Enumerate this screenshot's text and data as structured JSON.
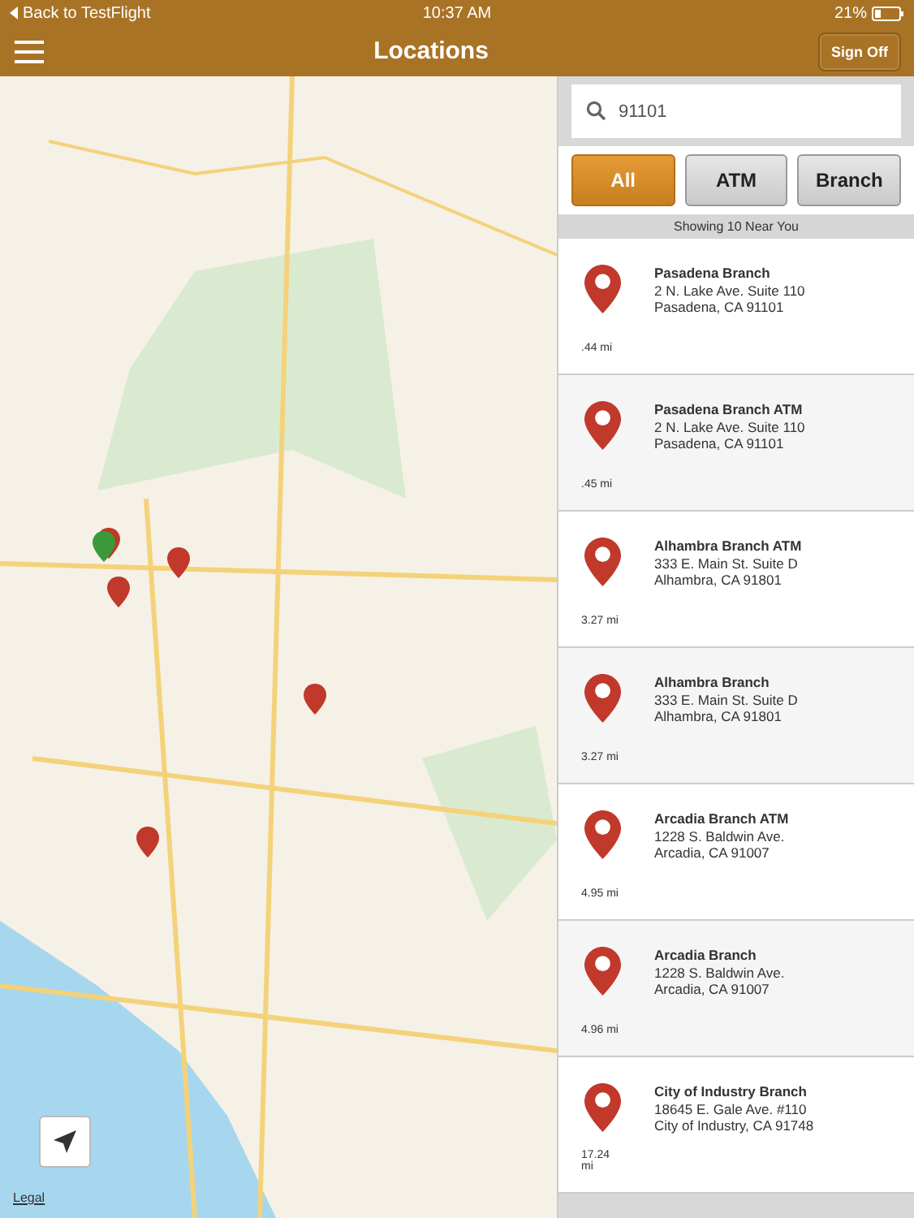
{
  "status_bar": {
    "back": "Back to TestFlight",
    "time": "10:37 AM",
    "battery": "21%"
  },
  "nav": {
    "title": "Locations",
    "action": "Sign Off"
  },
  "map": {
    "legal": "Legal"
  },
  "search": {
    "value": "91101"
  },
  "filters": [
    {
      "label": "All",
      "selected": true
    },
    {
      "label": "ATM",
      "selected": false
    },
    {
      "label": "Branch",
      "selected": false
    }
  ],
  "summary": "Showing 10 Near You",
  "locations": [
    {
      "name": "Pasadena Branch",
      "address": "2 N. Lake Ave. Suite 110",
      "city": "Pasadena, CA 91101",
      "distance": ".44 mi"
    },
    {
      "name": "Pasadena Branch ATM",
      "address": "2 N. Lake Ave. Suite 110",
      "city": "Pasadena, CA 91101",
      "distance": ".45 mi"
    },
    {
      "name": "Alhambra Branch ATM",
      "address": "333 E. Main St. Suite D",
      "city": "Alhambra, CA 91801",
      "distance": "3.27 mi"
    },
    {
      "name": "Alhambra Branch",
      "address": "333 E. Main St. Suite D",
      "city": "Alhambra, CA 91801",
      "distance": "3.27 mi"
    },
    {
      "name": "Arcadia Branch ATM",
      "address": "1228 S. Baldwin Ave.",
      "city": "Arcadia, CA 91007",
      "distance": "4.95 mi"
    },
    {
      "name": "Arcadia Branch",
      "address": "1228 S. Baldwin Ave.",
      "city": "Arcadia, CA 91007",
      "distance": "4.96 mi"
    },
    {
      "name": "City of Industry Branch",
      "address": "18645 E. Gale Ave. #110",
      "city": "City of Industry, CA 91748",
      "distance": "17.24 mi"
    }
  ]
}
